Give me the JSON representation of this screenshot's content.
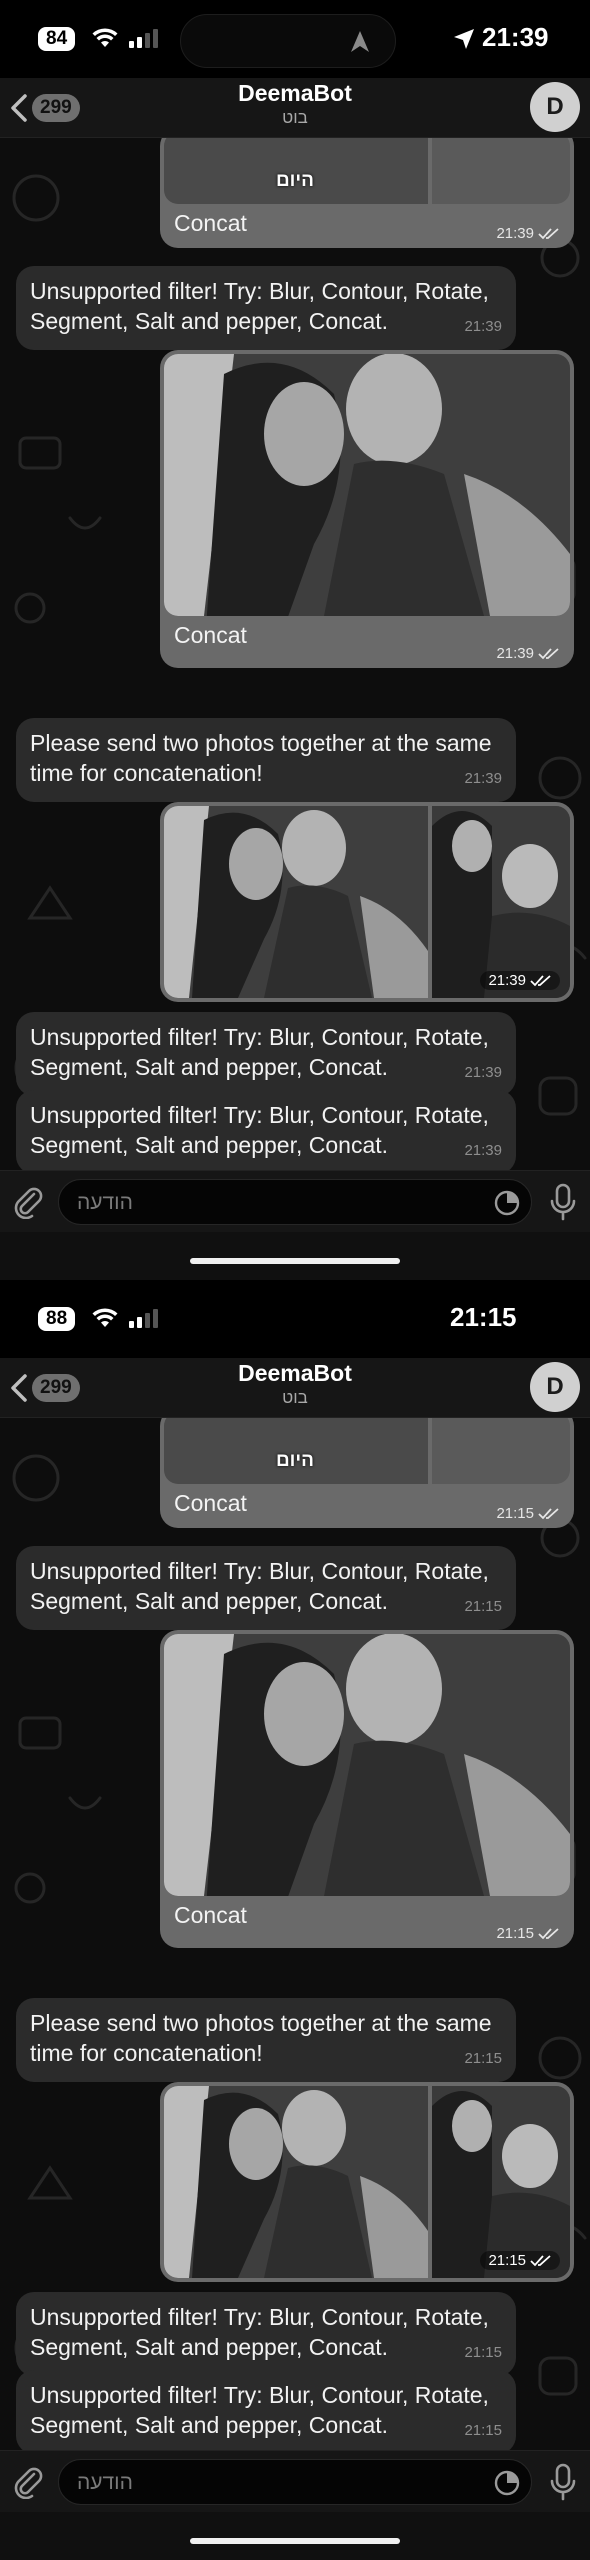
{
  "screens": [
    {
      "status": {
        "battery": "84",
        "time": "21:39",
        "show_location": true
      },
      "header": {
        "back_count": "299",
        "title": "DeemaBot",
        "subtitle": "בוט",
        "avatar_letter": "D"
      },
      "messages": {
        "concat_caption": "Concat",
        "day_label": "היום",
        "msg1_time": "21:39",
        "unsupported_text": "Unsupported filter! Try: Blur, Contour, Rotate, Segment, Salt and pepper, Concat.",
        "msg2_time": "21:39",
        "msg3_time": "21:39",
        "please_send_text": "Please send two photos together at the same time for concatenation!",
        "msg4_time": "21:39",
        "msg5_time": "21:39",
        "msg6_time": "21:39",
        "msg7_time": "21:39"
      },
      "input": {
        "placeholder": "הודעה"
      }
    },
    {
      "status": {
        "battery": "88",
        "time": "21:15",
        "show_location": false
      },
      "header": {
        "back_count": "299",
        "title": "DeemaBot",
        "subtitle": "בוט",
        "avatar_letter": "D"
      },
      "messages": {
        "concat_caption": "Concat",
        "day_label": "היום",
        "msg1_time": "21:15",
        "unsupported_text": "Unsupported filter! Try: Blur, Contour, Rotate, Segment, Salt and pepper, Concat.",
        "msg2_time": "21:15",
        "msg3_time": "21:15",
        "please_send_text": "Please send two photos together at the same time for concatenation!",
        "msg4_time": "21:15",
        "msg5_time": "21:15",
        "msg6_time": "21:15",
        "msg7_time": "21:15"
      },
      "input": {
        "placeholder": "הודעה"
      }
    }
  ],
  "colors": {
    "incoming_bubble": "#2b2b2b",
    "outgoing_bubble": "#6a6a6a",
    "background": "#0d0d0d"
  }
}
